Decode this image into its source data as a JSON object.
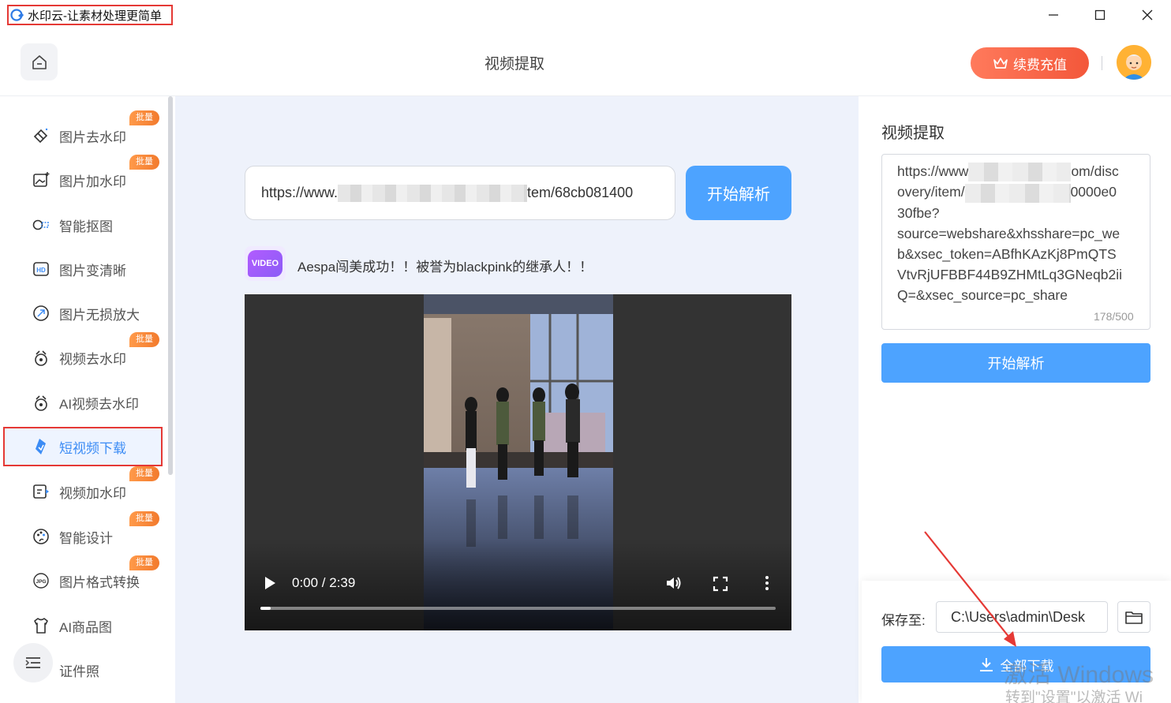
{
  "window": {
    "title": "水印云-让素材处理更简单",
    "controls": {
      "minimize": "─",
      "maximize": "☐",
      "close": "✕"
    }
  },
  "header": {
    "title": "视频提取",
    "recharge_label": "续费充值"
  },
  "sidebar": {
    "items": [
      {
        "label": "图片去水印",
        "icon": "eraser-icon",
        "badge": "批量"
      },
      {
        "label": "图片加水印",
        "icon": "image-add-icon",
        "badge": "批量"
      },
      {
        "label": "智能抠图",
        "icon": "cutout-icon",
        "badge": ""
      },
      {
        "label": "图片变清晰",
        "icon": "hd-icon",
        "badge": ""
      },
      {
        "label": "图片无损放大",
        "icon": "enlarge-icon",
        "badge": ""
      },
      {
        "label": "视频去水印",
        "icon": "video-eraser-icon",
        "badge": "批量"
      },
      {
        "label": "AI视频去水印",
        "icon": "ai-video-eraser-icon",
        "badge": ""
      },
      {
        "label": "短视频下载",
        "icon": "download-short-video-icon",
        "badge": "",
        "active": true
      },
      {
        "label": "视频加水印",
        "icon": "video-add-icon",
        "badge": "批量"
      },
      {
        "label": "智能设计",
        "icon": "design-icon",
        "badge": "批量"
      },
      {
        "label": "图片格式转换",
        "icon": "jpg-convert-icon",
        "badge": "批量"
      },
      {
        "label": "AI商品图",
        "icon": "shirt-icon",
        "badge": ""
      },
      {
        "label": "证件照",
        "icon": "id-photo-icon",
        "badge": ""
      }
    ]
  },
  "main": {
    "url_prefix": "https://www.",
    "url_suffix": "tem/68cb081400",
    "parse_label": "开始解析",
    "video_badge": "VIDEO",
    "video_title": "Aespa闯美成功！！被誉为blackpink的继承人！！",
    "player": {
      "time": "0:00 / 2:39",
      "progress": 0.02
    }
  },
  "right_panel": {
    "title": "视频提取",
    "textarea_lines": [
      {
        "pre": "https://www",
        "post": "om/disc"
      },
      {
        "pre": "overy/item/",
        "post": "0000e0"
      },
      {
        "pre": "30fbe?",
        "post": ""
      },
      {
        "pre": "source=webshare&xhsshare=pc_we",
        "post": ""
      },
      {
        "pre": "b&xsec_token=ABfhKAzKj8PmQTS",
        "post": ""
      },
      {
        "pre": "VtvRjUFBBF44B9ZHMtLq3GNeqb2ii",
        "post": ""
      },
      {
        "pre": "Q=&xsec_source=pc_share",
        "post": ""
      }
    ],
    "char_count": "178/500",
    "parse_label": "开始解析",
    "save_label": "保存至:",
    "save_path": "C:\\Users\\admin\\Desk",
    "download_label": "全部下载"
  },
  "os_watermark": {
    "line1": "激活 Windows",
    "line2": "转到\"设置\"以激活 Wi"
  },
  "colors": {
    "accent": "#4da3ff",
    "active_text": "#3c8cf5",
    "badge": "#f27a2d",
    "recharge": "#f3573a",
    "annotation_red": "#e53935"
  }
}
